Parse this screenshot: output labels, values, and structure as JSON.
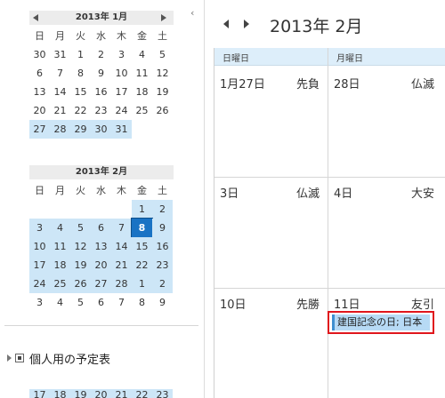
{
  "nav": {
    "collapse_glyph": "‹",
    "mini_jan": {
      "title": "2013年 1月",
      "weekdays": [
        "日",
        "月",
        "火",
        "水",
        "木",
        "金",
        "土"
      ],
      "weeks": [
        [
          "30",
          "31",
          "1",
          "2",
          "3",
          "4",
          "5"
        ],
        [
          "6",
          "7",
          "8",
          "9",
          "10",
          "11",
          "12"
        ],
        [
          "13",
          "14",
          "15",
          "16",
          "17",
          "18",
          "19"
        ],
        [
          "20",
          "21",
          "22",
          "23",
          "24",
          "25",
          "26"
        ],
        [
          "27",
          "28",
          "29",
          "30",
          "31",
          "",
          ""
        ]
      ]
    },
    "mini_feb": {
      "title": "2013年 2月",
      "weekdays": [
        "日",
        "月",
        "火",
        "水",
        "木",
        "金",
        "土"
      ],
      "weeks": [
        [
          "",
          "",
          "",
          "",
          "",
          "1",
          "2"
        ],
        [
          "3",
          "4",
          "5",
          "6",
          "7",
          "8",
          "9"
        ],
        [
          "10",
          "11",
          "12",
          "13",
          "14",
          "15",
          "16"
        ],
        [
          "17",
          "18",
          "19",
          "20",
          "21",
          "22",
          "23"
        ],
        [
          "24",
          "25",
          "26",
          "27",
          "28",
          "1",
          "2"
        ],
        [
          "3",
          "4",
          "5",
          "6",
          "7",
          "8",
          "9"
        ]
      ],
      "today": "8"
    },
    "calendar_group": "個人用の予定表",
    "peek_row": [
      "17",
      "18",
      "19",
      "20",
      "21",
      "22",
      "23"
    ]
  },
  "main": {
    "title": "2013年 2月",
    "day_headers": [
      "日曜日",
      "月曜日"
    ],
    "rows": [
      [
        {
          "day": "1月27日",
          "rokuyo": "先負"
        },
        {
          "day": "28日",
          "rokuyo": "仏滅"
        }
      ],
      [
        {
          "day": "3日",
          "rokuyo": "仏滅"
        },
        {
          "day": "4日",
          "rokuyo": "大安"
        }
      ],
      [
        {
          "day": "10日",
          "rokuyo": "先勝"
        },
        {
          "day": "11日",
          "rokuyo": "友引"
        }
      ]
    ],
    "event": {
      "label": "建国記念の日; 日本"
    },
    "colors": {
      "selection": "#cde6f7",
      "today": "#1a73c4",
      "event": "#b7daf5",
      "highlight_border": "#e0161c"
    }
  }
}
